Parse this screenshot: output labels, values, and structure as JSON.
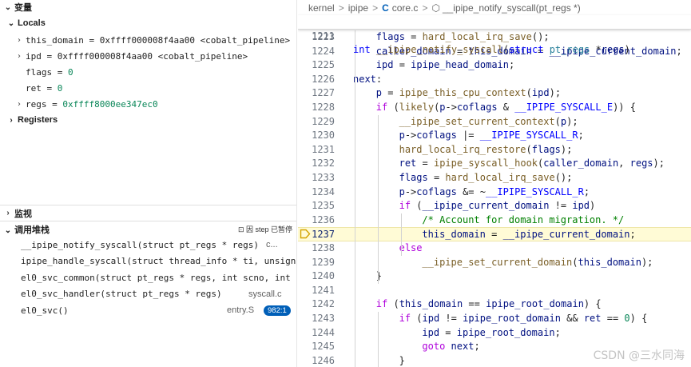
{
  "variables": {
    "title": "变量",
    "locals_label": "Locals",
    "rows": [
      {
        "name": "this_domain",
        "value": "0xffff000008f4aa00 <cobalt_pipeline>",
        "expandable": true
      },
      {
        "name": "ipd",
        "value": "0xffff000008f4aa00 <cobalt_pipeline>",
        "expandable": true
      },
      {
        "name": "flags",
        "value": "0",
        "expandable": false
      },
      {
        "name": "ret",
        "value": "0",
        "expandable": false
      },
      {
        "name": "regs",
        "value": "0xffff8000ee347ec0",
        "expandable": true
      }
    ],
    "registers_label": "Registers"
  },
  "watch": {
    "title": "监视"
  },
  "call_stack": {
    "title": "调用堆栈",
    "status": "因 step 已暂停",
    "frames": [
      {
        "func": "__ipipe_notify_syscall(struct pt_regs * regs)",
        "file": "c..."
      },
      {
        "func": "ipipe_handle_syscall(struct thread_info * ti, unsigned",
        "file": ""
      },
      {
        "func": "el0_svc_common(struct pt_regs * regs, int scno, int sc",
        "file": ""
      },
      {
        "func": "el0_svc_handler(struct pt_regs * regs)",
        "file": "syscall.c"
      },
      {
        "func": "el0_svc()",
        "file": "entry.S",
        "badge": "982:1"
      }
    ]
  },
  "breadcrumb": {
    "items": [
      "kernel",
      "ipipe",
      "core.c",
      "__ipipe_notify_syscall(pt_regs *)"
    ],
    "sep": ">"
  },
  "sticky": {
    "num": "1211",
    "text": "int __ipipe_notify_syscall(struct pt_regs *regs)"
  },
  "current_line": "1237",
  "lines": [
    {
      "num": "1223",
      "text": "flags = hard_local_irq_save();"
    },
    {
      "num": "1224",
      "text": "caller_domain = this_domain = __ipipe_current_domain;"
    },
    {
      "num": "1225",
      "text": "ipd = ipipe_head_domain;"
    },
    {
      "num": "1226",
      "text": "next:"
    },
    {
      "num": "1227",
      "text": "p = ipipe_this_cpu_context(ipd);"
    },
    {
      "num": "1228",
      "text": "if (likely(p->coflags & __IPIPE_SYSCALL_E)) {"
    },
    {
      "num": "1229",
      "text": "__ipipe_set_current_context(p);"
    },
    {
      "num": "1230",
      "text": "p->coflags |= __IPIPE_SYSCALL_R;"
    },
    {
      "num": "1231",
      "text": "hard_local_irq_restore(flags);"
    },
    {
      "num": "1232",
      "text": "ret = ipipe_syscall_hook(caller_domain, regs);"
    },
    {
      "num": "1233",
      "text": "flags = hard_local_irq_save();"
    },
    {
      "num": "1234",
      "text": "p->coflags &= ~__IPIPE_SYSCALL_R;"
    },
    {
      "num": "1235",
      "text": "if (__ipipe_current_domain != ipd)"
    },
    {
      "num": "1236",
      "text": "/* Account for domain migration. */"
    },
    {
      "num": "1237",
      "text": "this_domain = __ipipe_current_domain;"
    },
    {
      "num": "1238",
      "text": "else"
    },
    {
      "num": "1239",
      "text": "__ipipe_set_current_domain(this_domain);"
    },
    {
      "num": "1240",
      "text": "}"
    },
    {
      "num": "1241",
      "text": ""
    },
    {
      "num": "1242",
      "text": "if (this_domain == ipipe_root_domain) {"
    },
    {
      "num": "1243",
      "text": "if (ipd != ipipe_root_domain && ret == 0) {"
    },
    {
      "num": "1244",
      "text": "ipd = ipipe_root_domain;"
    },
    {
      "num": "1245",
      "text": "goto next;"
    },
    {
      "num": "1246",
      "text": "}"
    }
  ],
  "watermark": "CSDN @三水同海",
  "colors": {
    "accent": "#005fb8",
    "current_line_bg": "#fffbd6",
    "keyword": "#0000ff",
    "function": "#795e26"
  }
}
